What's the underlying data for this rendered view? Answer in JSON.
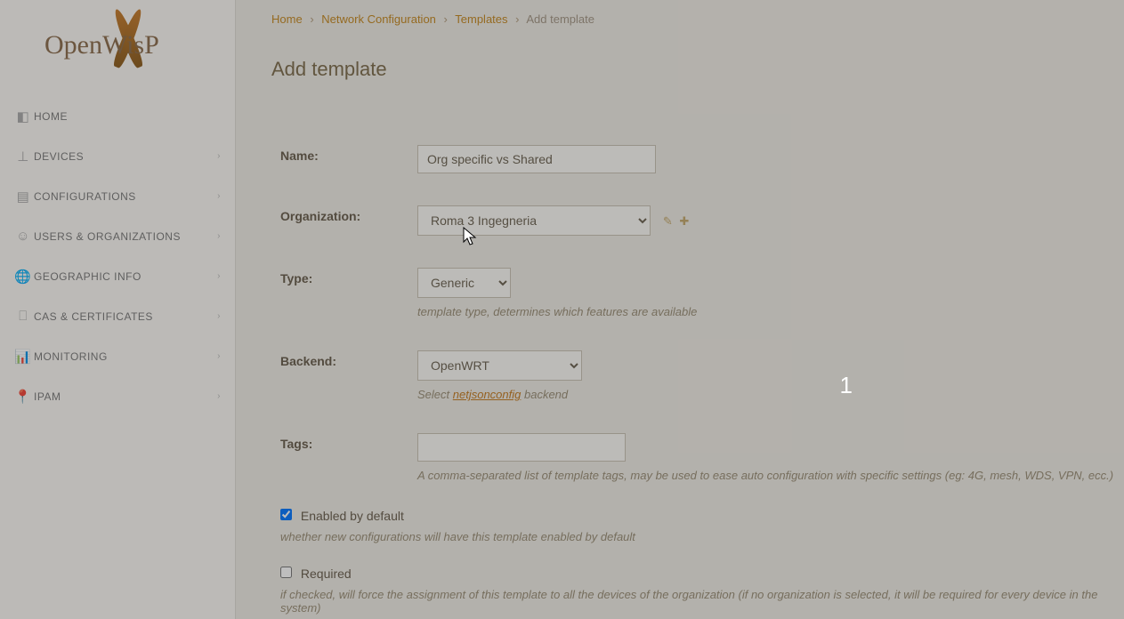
{
  "brand": "OpenWisP",
  "sidebar": {
    "items": [
      {
        "label": "HOME"
      },
      {
        "label": "DEVICES"
      },
      {
        "label": "CONFIGURATIONS"
      },
      {
        "label": "USERS & ORGANIZATIONS"
      },
      {
        "label": "GEOGRAPHIC INFO"
      },
      {
        "label": "CAS & CERTIFICATES"
      },
      {
        "label": "MONITORING"
      },
      {
        "label": "IPAM"
      }
    ]
  },
  "breadcrumb": {
    "home": "Home",
    "l1": "Network Configuration",
    "l2": "Templates",
    "current": "Add template"
  },
  "page_title": "Add template",
  "form": {
    "name": {
      "label": "Name:",
      "value": "Org specific vs Shared"
    },
    "organization": {
      "label": "Organization:",
      "value": "Roma 3 Ingegneria"
    },
    "type": {
      "label": "Type:",
      "value": "Generic",
      "help": "template type, determines which features are available"
    },
    "backend": {
      "label": "Backend:",
      "value": "OpenWRT",
      "help_pre": "Select ",
      "help_link": "netjsonconfig",
      "help_post": " backend"
    },
    "tags": {
      "label": "Tags:",
      "value": "",
      "help": "A comma-separated list of template tags, may be used to ease auto configuration with specific settings (eg: 4G, mesh, WDS, VPN, ecc.)"
    },
    "enabled": {
      "label": "Enabled by default",
      "help": "whether new configurations will have this template enabled by default"
    },
    "required": {
      "label": "Required",
      "help": "if checked, will force the assignment of this template to all the devices of the organization (if no organization is selected, it will be required for every device in the system)"
    }
  },
  "floating_number": "1"
}
